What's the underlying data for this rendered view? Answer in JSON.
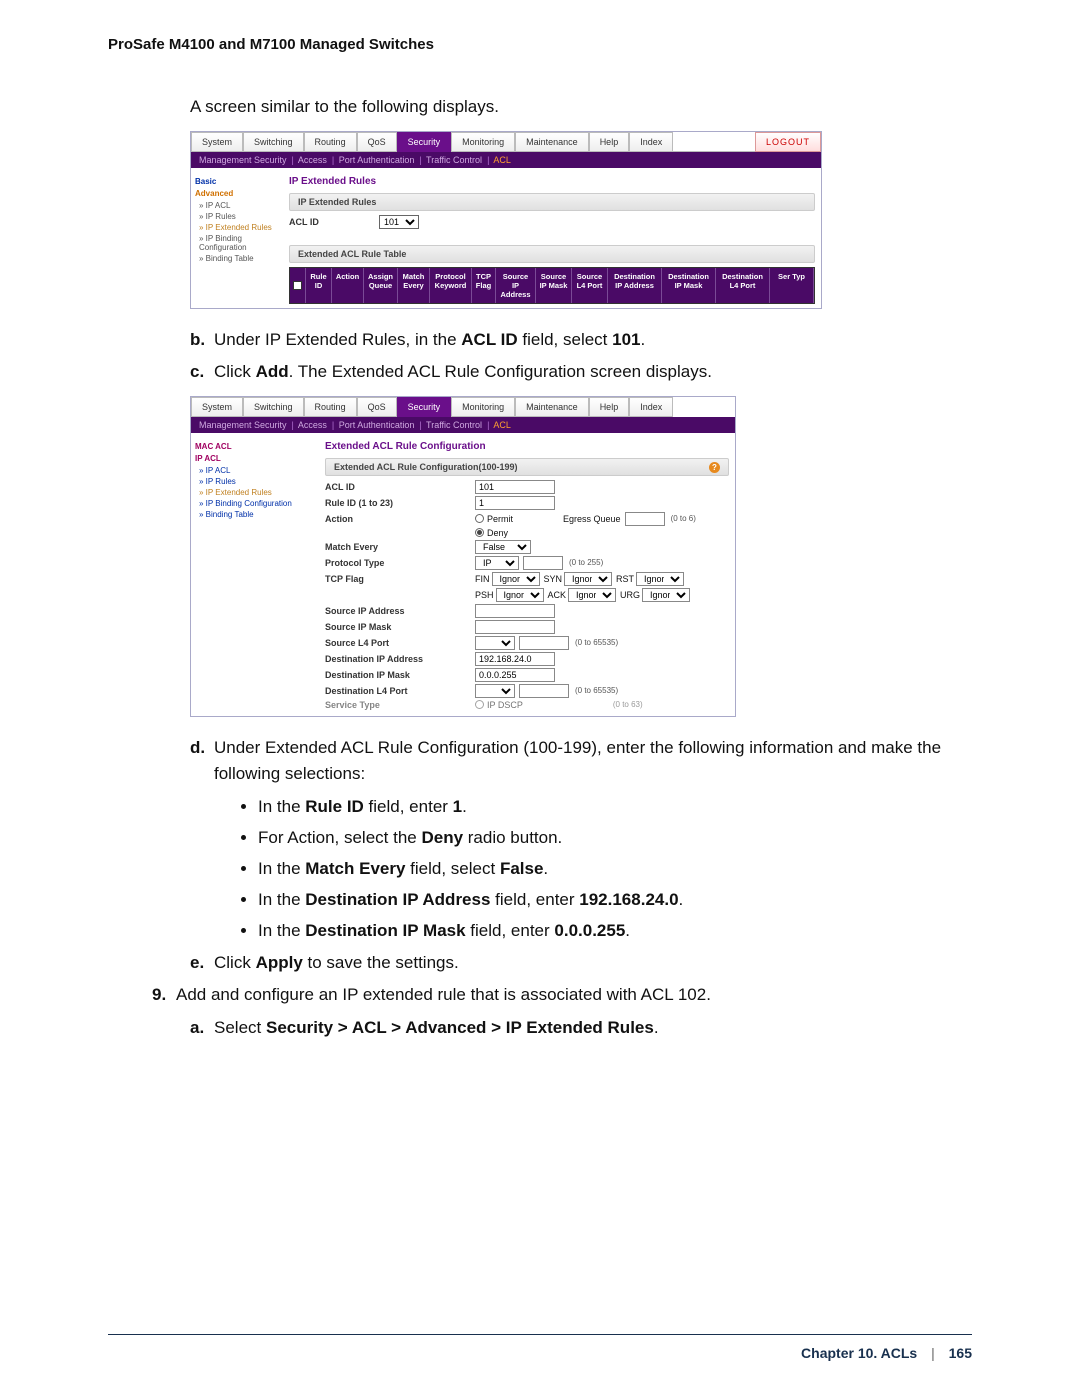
{
  "header": {
    "running_head": "ProSafe M4100 and M7100 Managed Switches"
  },
  "intro": "A screen similar to the following displays.",
  "shot1": {
    "tabs": [
      "System",
      "Switching",
      "Routing",
      "QoS",
      "Security",
      "Monitoring",
      "Maintenance",
      "Help",
      "Index"
    ],
    "active_tab": "Security",
    "logout": "LOGOUT",
    "subnav": [
      "Management Security",
      "Access",
      "Port Authentication",
      "Traffic Control",
      "ACL"
    ],
    "subnav_hl": "ACL",
    "side": {
      "hd1": "Basic",
      "hd2": "Advanced",
      "items": [
        "» IP ACL",
        "» IP Rules",
        "» IP Extended Rules",
        "» IP Binding Configuration",
        "» Binding Table"
      ],
      "cur": "» IP Extended Rules"
    },
    "sec_title": "IP Extended Rules",
    "bar1": "IP Extended Rules",
    "acl_id_label": "ACL ID",
    "acl_id_value": "101",
    "bar2": "Extended ACL Rule Table",
    "cols": [
      "Rule ID",
      "Action",
      "Assign Queue",
      "Match Every",
      "Protocol Keyword",
      "TCP Flag",
      "Source IP Address",
      "Source IP Mask",
      "Source L4 Port",
      "Destination IP Address",
      "Destination IP Mask",
      "Destination L4 Port",
      "Ser Typ"
    ]
  },
  "steps_bc": {
    "b_pre": "Under IP Extended Rules, in the ",
    "b_bold1": "ACL ID",
    "b_mid": " field, select ",
    "b_bold2": "101",
    "b_post": ".",
    "c_pre": "Click ",
    "c_bold": "Add",
    "c_post": ". The Extended ACL Rule Configuration screen displays."
  },
  "shot2": {
    "tabs": [
      "System",
      "Switching",
      "Routing",
      "QoS",
      "Security",
      "Monitoring",
      "Maintenance",
      "Help",
      "Index"
    ],
    "active_tab": "Security",
    "subnav": [
      "Management Security",
      "Access",
      "Port Authentication",
      "Traffic Control",
      "ACL"
    ],
    "subnav_hl": "ACL",
    "side": {
      "hd1": "MAC ACL",
      "hd2": "IP ACL",
      "items": [
        "» IP ACL",
        "» IP Rules",
        "» IP Extended Rules",
        "» IP Binding Configuration",
        "» Binding Table"
      ],
      "cur": "» IP Extended Rules"
    },
    "sec_title": "Extended ACL Rule Configuration",
    "bar1": "Extended ACL Rule Configuration(100-199)",
    "fields": {
      "acl_id": {
        "label": "ACL ID",
        "value": "101"
      },
      "rule_id": {
        "label": "Rule ID (1 to 23)",
        "value": "1"
      },
      "action": {
        "label": "Action",
        "permit": "Permit",
        "deny": "Deny",
        "egress": "Egress Queue",
        "egress_range": "(0 to 6)"
      },
      "match_every": {
        "label": "Match Every",
        "value": "False"
      },
      "protocol_type": {
        "label": "Protocol Type",
        "value": "IP",
        "range": "(0 to 255)"
      },
      "tcp_flag": {
        "label": "TCP Flag",
        "flags": [
          {
            "n": "FIN",
            "v": "Ignore"
          },
          {
            "n": "SYN",
            "v": "Ignore"
          },
          {
            "n": "RST",
            "v": "Ignore"
          },
          {
            "n": "PSH",
            "v": "Ignore"
          },
          {
            "n": "ACK",
            "v": "Ignore"
          },
          {
            "n": "URG",
            "v": "Ignore"
          }
        ]
      },
      "src_ip": {
        "label": "Source IP Address",
        "value": ""
      },
      "src_mask": {
        "label": "Source IP Mask",
        "value": ""
      },
      "src_port": {
        "label": "Source L4 Port",
        "value": "",
        "range": "(0 to 65535)"
      },
      "dst_ip": {
        "label": "Destination IP Address",
        "value": "192.168.24.0"
      },
      "dst_mask": {
        "label": "Destination IP Mask",
        "value": "0.0.0.255"
      },
      "dst_port": {
        "label": "Destination L4 Port",
        "value": "",
        "range": "(0 to 65535)"
      },
      "svc_type": {
        "label": "Service Type",
        "opt": "IP DSCP",
        "range": "(0 to 63)"
      }
    }
  },
  "step_d": {
    "intro": "Under Extended ACL Rule Configuration (100-199), enter the following information and make the following selections:",
    "bullets": {
      "b1_pre": "In the ",
      "b1_b": "Rule ID",
      "b1_mid": " field, enter ",
      "b1_v": "1",
      "b1_post": ".",
      "b2_pre": "For Action, select the ",
      "b2_b": "Deny",
      "b2_post": " radio button.",
      "b3_pre": "In the ",
      "b3_b": "Match Every",
      "b3_mid": " field, select ",
      "b3_v": "False",
      "b3_post": ".",
      "b4_pre": "In the ",
      "b4_b": "Destination IP Address",
      "b4_mid": " field, enter ",
      "b4_v": "192.168.24.0",
      "b4_post": ".",
      "b5_pre": "In the ",
      "b5_b": "Destination IP Mask",
      "b5_mid": " field, enter ",
      "b5_v": "0.0.0.255",
      "b5_post": "."
    }
  },
  "step_e": {
    "pre": "Click ",
    "b": "Apply",
    "post": " to save the settings."
  },
  "step_9": {
    "text": "Add and configure an IP extended rule that is associated with ACL 102."
  },
  "step_9a": {
    "pre": "Select ",
    "b": "Security > ACL > Advanced > IP Extended Rules",
    "post": "."
  },
  "footer": {
    "chapter": "Chapter 10.  ACLs",
    "page": "165"
  }
}
